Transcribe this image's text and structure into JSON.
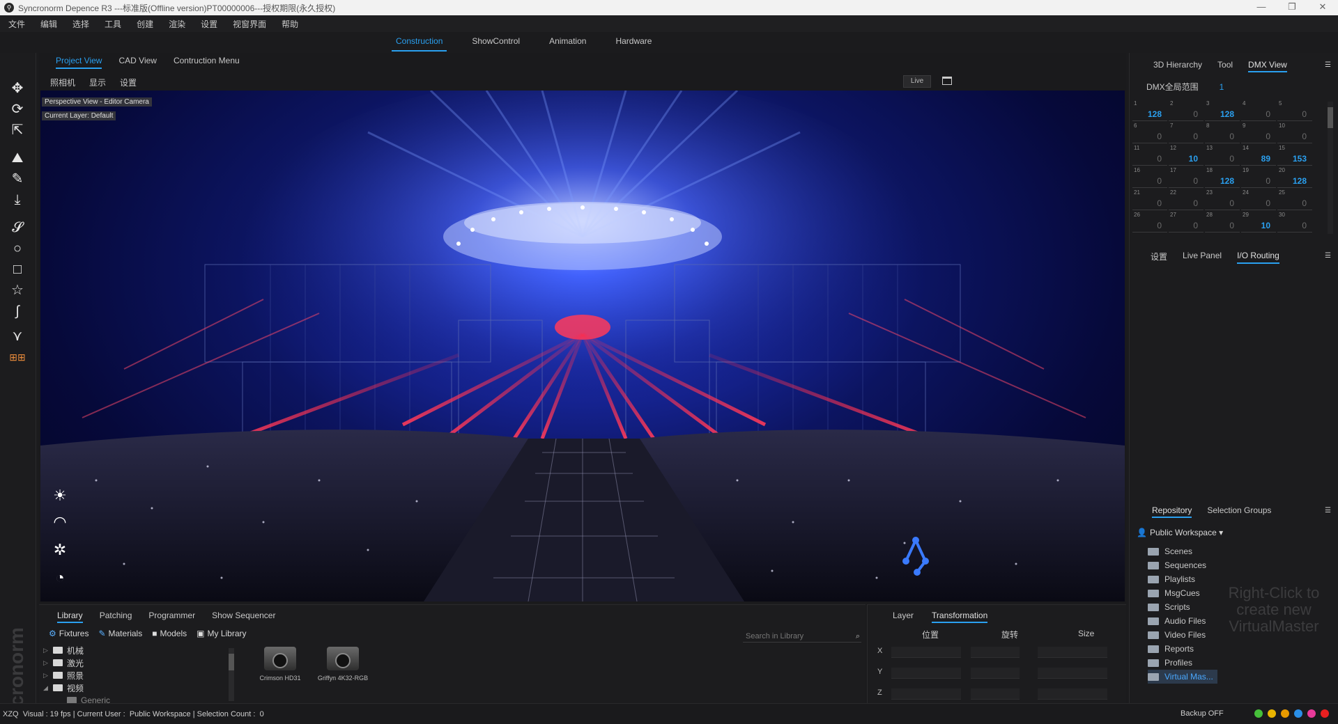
{
  "window": {
    "title": "Syncronorm Depence R3 ---标准版(Offline version)PT00000006---授权期限(永久授权)",
    "controls": [
      "—",
      "❐",
      "✕"
    ]
  },
  "menu": [
    "文件",
    "编辑",
    "选择",
    "工具",
    "创建",
    "渲染",
    "设置",
    "视窗界面",
    "帮助"
  ],
  "mode_tabs": [
    {
      "label": "Construction",
      "active": true
    },
    {
      "label": "ShowControl",
      "active": false
    },
    {
      "label": "Animation",
      "active": false
    },
    {
      "label": "Hardware",
      "active": false
    }
  ],
  "left_tools": [
    "move-icon",
    "rotate-icon",
    "scale-icon",
    "terrain-icon",
    "paint-icon",
    "drop-icon",
    "spline-icon",
    "circle-icon",
    "square-icon",
    "star-icon",
    "curve-icon",
    "logo-tool-icon",
    "truss-icon"
  ],
  "watermark": "Syncronorm",
  "view": {
    "tabs": [
      {
        "label": "Project View",
        "active": true
      },
      {
        "label": "CAD View",
        "active": false
      },
      {
        "label": "Contruction Menu",
        "active": false
      }
    ],
    "subtabs": [
      "照相机",
      "显示",
      "设置"
    ],
    "live_label": "Live",
    "perspective_label": "Perspective View - Editor Camera",
    "layer_label": "Current Layer: Default",
    "scene_tools": [
      "sun-icon",
      "gauge-icon",
      "fan-icon",
      "timer-icon"
    ]
  },
  "library": {
    "tabs": [
      {
        "label": "Library",
        "active": true
      },
      {
        "label": "Patching",
        "active": false
      },
      {
        "label": "Programmer",
        "active": false
      },
      {
        "label": "Show Sequencer",
        "active": false
      }
    ],
    "categories": [
      "Fixtures",
      "Materials",
      "Models",
      "My Library"
    ],
    "search_placeholder": "Search in Library",
    "tree": [
      {
        "label": "机械",
        "arrow": "▷"
      },
      {
        "label": "激光",
        "arrow": "▷"
      },
      {
        "label": "照景",
        "arrow": "▷"
      },
      {
        "label": "视频",
        "arrow": "◢"
      },
      {
        "label": "Generic",
        "arrow": ""
      }
    ],
    "fixtures": [
      "Crimson HD31",
      "Griffyn 4K32-RGB"
    ]
  },
  "transformation": {
    "tabs": [
      {
        "label": "Layer",
        "active": false
      },
      {
        "label": "Transformation",
        "active": true
      }
    ],
    "columns": [
      "位置",
      "旋转",
      "Size"
    ],
    "axes": [
      "X",
      "Y",
      "Z"
    ]
  },
  "right": {
    "top_tabs": [
      {
        "label": "3D Hierarchy",
        "active": false
      },
      {
        "label": "Tool",
        "active": false
      },
      {
        "label": "DMX View",
        "active": true
      }
    ],
    "dmx_range_label": "DMX全局范围",
    "dmx_range_value": "1",
    "dmx_channels": [
      {
        "ch": "1",
        "v": "128",
        "hot": true
      },
      {
        "ch": "2",
        "v": "0",
        "hot": false
      },
      {
        "ch": "3",
        "v": "128",
        "hot": true
      },
      {
        "ch": "4",
        "v": "0",
        "hot": false
      },
      {
        "ch": "5",
        "v": "0",
        "hot": false
      },
      {
        "ch": "6",
        "v": "0",
        "hot": false
      },
      {
        "ch": "7",
        "v": "0",
        "hot": false
      },
      {
        "ch": "8",
        "v": "0",
        "hot": false
      },
      {
        "ch": "9",
        "v": "0",
        "hot": false
      },
      {
        "ch": "10",
        "v": "0",
        "hot": false
      },
      {
        "ch": "11",
        "v": "0",
        "hot": false
      },
      {
        "ch": "12",
        "v": "10",
        "hot": true
      },
      {
        "ch": "13",
        "v": "0",
        "hot": false
      },
      {
        "ch": "14",
        "v": "89",
        "hot": true
      },
      {
        "ch": "15",
        "v": "153",
        "hot": true
      },
      {
        "ch": "16",
        "v": "0",
        "hot": false
      },
      {
        "ch": "17",
        "v": "0",
        "hot": false
      },
      {
        "ch": "18",
        "v": "128",
        "hot": true
      },
      {
        "ch": "19",
        "v": "0",
        "hot": false
      },
      {
        "ch": "20",
        "v": "128",
        "hot": true
      },
      {
        "ch": "21",
        "v": "0",
        "hot": false
      },
      {
        "ch": "22",
        "v": "0",
        "hot": false
      },
      {
        "ch": "23",
        "v": "0",
        "hot": false
      },
      {
        "ch": "24",
        "v": "0",
        "hot": false
      },
      {
        "ch": "25",
        "v": "0",
        "hot": false
      },
      {
        "ch": "26",
        "v": "0",
        "hot": false
      },
      {
        "ch": "27",
        "v": "0",
        "hot": false
      },
      {
        "ch": "28",
        "v": "0",
        "hot": false
      },
      {
        "ch": "29",
        "v": "10",
        "hot": true
      },
      {
        "ch": "30",
        "v": "0",
        "hot": false
      }
    ],
    "mid_tabs": [
      {
        "label": "设置",
        "active": false
      },
      {
        "label": "Live Panel",
        "active": false
      },
      {
        "label": "I/O Routing",
        "active": true
      }
    ],
    "repo_tabs": [
      {
        "label": "Repository",
        "active": true
      },
      {
        "label": "Selection Groups",
        "active": false
      }
    ],
    "workspace": "Public Workspace",
    "repo_items": [
      "Scenes",
      "Sequences",
      "Playlists",
      "MsgCues",
      "Scripts",
      "Audio Files",
      "Video Files",
      "Reports",
      "Profiles",
      "Virtual Mas..."
    ],
    "repo_selected": "Virtual Mas...",
    "repo_hint": "Right-Click to create new VirtualMaster"
  },
  "status": {
    "user_short": "XZQ",
    "visual": "Visual : 19 fps",
    "current_user": "| Current User :",
    "workspace": "Public Workspace",
    "selection": "| Selection Count :",
    "selection_count": "0",
    "backup": "Backup OFF",
    "indicator_colors": [
      "#46c03a",
      "#e8b400",
      "#e89a00",
      "#2a8fe8",
      "#e83a9a",
      "#e82020"
    ]
  },
  "colors": {
    "accent": "#2aa0f0"
  }
}
